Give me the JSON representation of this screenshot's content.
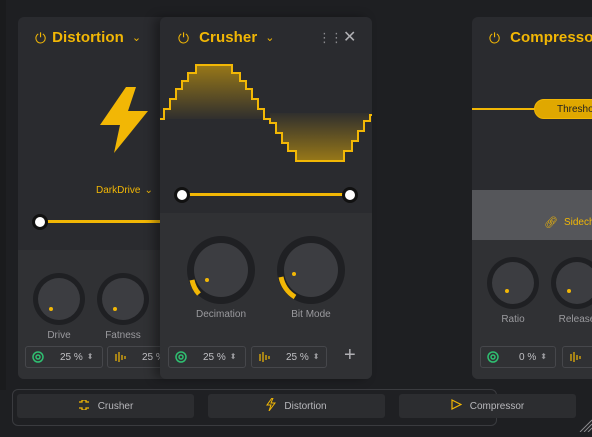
{
  "modules": {
    "distortion": {
      "title": "Distortion",
      "preset": "DarkDrive",
      "knobs": [
        {
          "label": "Drive",
          "value": 0.0
        },
        {
          "label": "Fatness",
          "value": 0.0
        }
      ],
      "mix_value": "25 %",
      "second_value": "25 %"
    },
    "crusher": {
      "title": "Crusher",
      "knobs": [
        {
          "label": "Decimation",
          "value": 0.18
        },
        {
          "label": "Bit Mode",
          "value": 0.15
        }
      ],
      "mix_value": "25 %",
      "second_value": "25 %"
    },
    "compressor": {
      "title": "Compressor",
      "threshold_label": "Thresho",
      "sidechain_label": "Sidech",
      "knobs": [
        {
          "label": "Ratio",
          "value": 0.0
        },
        {
          "label": "Release",
          "value": 0.0
        }
      ],
      "mix_value": "0 %"
    }
  },
  "bottom_tabs": [
    {
      "label": "Crusher",
      "icon": "crusher-icon"
    },
    {
      "label": "Distortion",
      "icon": "lightning-icon"
    },
    {
      "label": "Compressor",
      "icon": "play-triangle-icon"
    }
  ],
  "colors": {
    "accent": "#f2b705",
    "mix_icon": "#2fbf71",
    "panel": "#2a2b2f",
    "background": "#1e1f22"
  }
}
